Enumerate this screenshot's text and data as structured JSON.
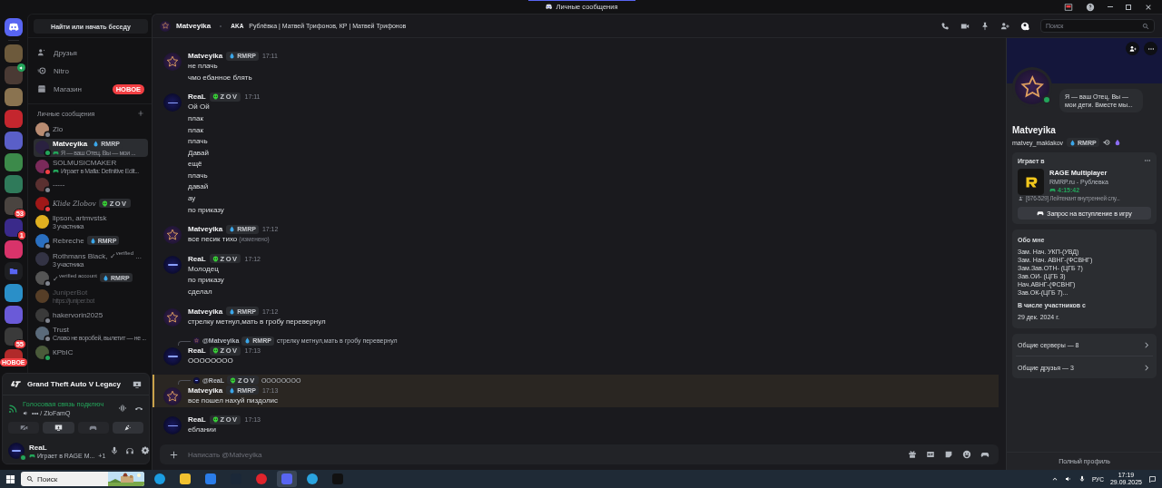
{
  "titlebar": {
    "title": "Личные сообщения"
  },
  "servers": [
    {
      "kind": "home"
    },
    {
      "kind": "picture",
      "color": "#6d5a3c"
    },
    {
      "kind": "picture",
      "color": "#4a3a34",
      "voice": true
    },
    {
      "kind": "picture",
      "color": "#8a7350"
    },
    {
      "kind": "picture",
      "color": "#c4262e"
    },
    {
      "kind": "picture",
      "color": "#5a5fc8"
    },
    {
      "kind": "picture",
      "color": "#3c8a4a"
    },
    {
      "kind": "picture",
      "color": "#2f7a5a"
    },
    {
      "kind": "picture",
      "color": "#4a4440",
      "badge": "53"
    },
    {
      "kind": "picture",
      "color": "#3a2a8a",
      "badge": "1"
    },
    {
      "kind": "picture",
      "color": "#d8336a"
    },
    {
      "kind": "folder"
    },
    {
      "kind": "picture",
      "color": "#2a8fc8"
    },
    {
      "kind": "picture",
      "color": "#6a5ad8"
    },
    {
      "kind": "picture",
      "color": "#3a3a3a",
      "badge": "55"
    },
    {
      "kind": "picture",
      "color": "#b02a2a",
      "badge": "НОВОЕ"
    }
  ],
  "sidebar": {
    "search": "Найти или начать беседу",
    "nav": [
      {
        "kind": "friends",
        "label": "Друзья"
      },
      {
        "kind": "nitro",
        "label": "Nitro"
      },
      {
        "kind": "shop",
        "label": "Магазин",
        "badge": "НОВОЕ"
      }
    ],
    "dm_header": "Личные сообщения"
  },
  "dms": [
    {
      "name": "Zlo",
      "color": "#80848e",
      "selected": false
    },
    {
      "name": "Matveyika",
      "tag": {
        "kind": "rmrp",
        "label": "RMRP"
      },
      "subtitle": "Я — ваш Отец. Вы — мои ...",
      "game": true,
      "color": "#23a55a",
      "selected": true
    },
    {
      "name": "SOLMUSICMAKER",
      "subtitle": "Играет в Mafia: Definitive Edit...",
      "game": true,
      "color": "#f23f43",
      "selected": false
    },
    {
      "name": "-----",
      "color": "#80848e",
      "selected": false
    },
    {
      "name": "Klide Zlobov",
      "italic": true,
      "tag": {
        "kind": "zov",
        "label": "ZOV"
      },
      "color": "#f23f43",
      "selected": false
    },
    {
      "name": "lipson, artmvstsk",
      "subtitle": "3 участника",
      "selected": false
    },
    {
      "name": "Rebreche",
      "tag": {
        "kind": "rmrp",
        "label": "RMRP"
      },
      "color": "#80848e",
      "selected": false
    },
    {
      "name": "Rothmans Black, ✓$^{verified}$ ...",
      "subtitle": "3 участника",
      "selected": false
    },
    {
      "name": "✓$^{verified account}$",
      "tag": {
        "kind": "rmrp",
        "label": "RMRP"
      },
      "color": "#80848e",
      "selected": false
    },
    {
      "name": "JuniperBot",
      "subtitle": "https://juniper.bot",
      "muted": true,
      "selected": false
    },
    {
      "name": "hakervorin2025",
      "color": "#80848e",
      "selected": false
    },
    {
      "name": "Trust",
      "subtitle": "Слово не воробей, вылетит — не ...",
      "color": "#80848e",
      "selected": false
    },
    {
      "name": "КРbIC",
      "color": "#23a55a",
      "selected": false
    }
  ],
  "panel": {
    "game": "Grand Theft Auto V Legacy",
    "voice_status": "Голосовая связь подключ",
    "voice_channel": "••• / ZloFamQ",
    "buttons": [
      {
        "kind": "camera",
        "selected": false
      },
      {
        "kind": "screen",
        "selected": true
      },
      {
        "kind": "game",
        "selected": false
      },
      {
        "kind": "activity",
        "selected": true
      }
    ],
    "user": {
      "name": "ReaL",
      "activity": "Играет в RAGE M...",
      "extra": "+1",
      "color": "#23a55a"
    }
  },
  "chat": {
    "name": "Matveyika",
    "aka": "AKA",
    "aka_names": "Рублёвка | Матвей Трифонов, КР | Матвей Трифонов",
    "search": "Поиск",
    "placeholder": "Написать @Matveyika"
  },
  "messages": [
    {
      "author": "Matveyika",
      "kind": "star",
      "tag": {
        "kind": "rmrp",
        "label": "RMRP"
      },
      "time": "17:11",
      "lines": [
        "не плачь",
        "чмо ебанное блять"
      ],
      "highlighted": false
    },
    {
      "author": "ReaL",
      "kind": "dark",
      "tag": {
        "kind": "zov",
        "label": "ZOV"
      },
      "time": "17:11",
      "lines": [
        "Ой Ой",
        "плак",
        "плак",
        "плачь",
        "Давай",
        "ещё",
        "плачь",
        "давай",
        "ау",
        "по приказу"
      ],
      "highlighted": false
    },
    {
      "author": "Matveyika",
      "kind": "star",
      "tag": {
        "kind": "rmrp",
        "label": "RMRP"
      },
      "time": "17:12",
      "lines": [
        "все песик тихо"
      ],
      "edited": "(изменено)",
      "highlighted": false
    },
    {
      "author": "ReaL",
      "kind": "dark",
      "tag": {
        "kind": "zov",
        "label": "ZOV"
      },
      "time": "17:12",
      "lines": [
        "Молодец",
        "по приказу",
        "сделал"
      ],
      "highlighted": false
    },
    {
      "author": "Matveyika",
      "kind": "star",
      "tag": {
        "kind": "rmrp",
        "label": "RMRP"
      },
      "time": "17:12",
      "lines": [
        "стрелку метнул,мать в гробу перевернул"
      ],
      "highlighted": false
    },
    {
      "author": "ReaL",
      "kind": "dark",
      "tag": {
        "kind": "zov",
        "label": "ZOV"
      },
      "time": "17:13",
      "lines": [
        "OOOOOOOO"
      ],
      "highlighted": false,
      "reply": {
        "author": "@Matveyika",
        "kind": "star",
        "tag": {
          "kind": "rmrp",
          "label": "RMRP"
        },
        "text": "стрелку метнул,мать в гробу перевернул"
      }
    },
    {
      "author": "Matveyika",
      "kind": "star",
      "tag": {
        "kind": "rmrp",
        "label": "RMRP"
      },
      "time": "17:13",
      "lines": [
        "все пошел нахуй пиздолис"
      ],
      "highlighted": true,
      "reply": {
        "author": "@ReaL",
        "kind": "dark",
        "tag": {
          "kind": "zov",
          "label": "ZOV"
        },
        "text": "OOOOOOOO"
      }
    },
    {
      "author": "ReaL",
      "kind": "dark",
      "tag": {
        "kind": "zov",
        "label": "ZOV"
      },
      "time": "17:13",
      "lines": [
        "еблании"
      ],
      "highlighted": false
    }
  ],
  "profile": {
    "status_text": "Я — ваш Отец. Вы — мои дети. Вместе мы...",
    "name": "Matveyika",
    "username": "matvey_maklakov",
    "tag": {
      "kind": "rmrp",
      "label": "RMRP"
    },
    "color": "#23a55a",
    "activity": {
      "heading": "Играет в",
      "game": "RAGE Multiplayer",
      "details": "RMRP.ru - Рублевка",
      "elapsed": "4:15:42",
      "state": "[676-529] Лейтенант внутренней слу...",
      "button": "Запрос на вступление в игру"
    },
    "about_heading": "Обо мне",
    "about": [
      "Зам. Нач. УКП-(УВД)",
      "Зам. Нач. АВНГ-(ФСВНГ)",
      "Зам.Зав.ОТН- (ЦГБ 7)",
      "Зав.ОИ- (ЦГБ 3)",
      "Нач.АВНГ-(ФСВНГ)",
      "Зав.ОК-(ЦГБ 7)..."
    ],
    "member_heading": "В числе участников с",
    "member_since": "29 дек. 2024 г.",
    "links": [
      "Общие серверы — 8",
      "Общие друзья — 3"
    ],
    "full_profile": "Полный профиль"
  },
  "taskbar": {
    "search": "Поиск",
    "apps": [
      {
        "kind": "edge",
        "selected": false
      },
      {
        "kind": "explorer",
        "selected": false
      },
      {
        "kind": "store",
        "selected": false
      },
      {
        "kind": "steam",
        "selected": false
      },
      {
        "kind": "opera",
        "selected": false
      },
      {
        "kind": "discord",
        "selected": true
      },
      {
        "kind": "telegram",
        "selected": false
      },
      {
        "kind": "rage",
        "selected": false
      }
    ],
    "lang": "РУС",
    "time": "17:19",
    "date": "29.09.2025"
  }
}
